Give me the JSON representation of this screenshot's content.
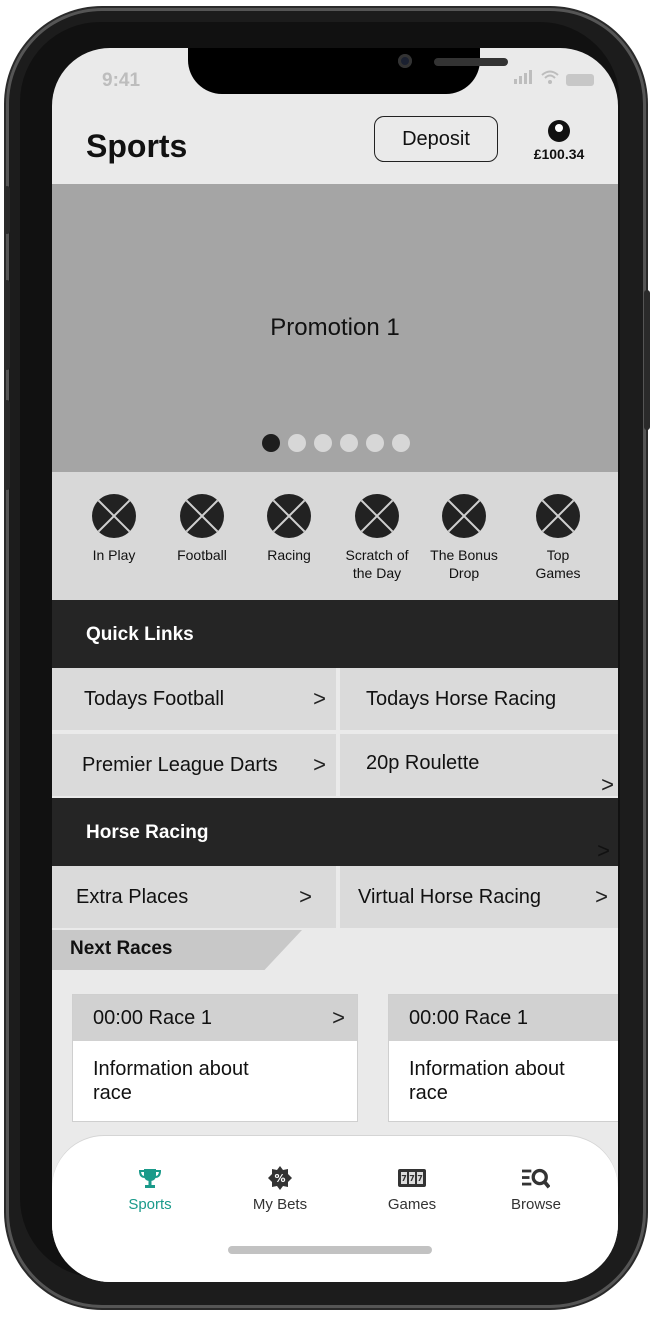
{
  "status_bar": {
    "time": "9:41"
  },
  "header": {
    "title": "Sports",
    "deposit_label": "Deposit",
    "balance": "£100.34"
  },
  "promo": {
    "label": "Promotion 1",
    "slide_count": 6,
    "active_slide": 1
  },
  "categories": [
    {
      "label": "In Play"
    },
    {
      "label": "Football"
    },
    {
      "label": "Racing"
    },
    {
      "label": "Scratch of\nthe Day"
    },
    {
      "label": "The Bonus\nDrop"
    },
    {
      "label": "Top\nGames"
    }
  ],
  "quick_links": {
    "title": "Quick Links",
    "items": [
      {
        "label": "Todays Football"
      },
      {
        "label": "Todays Horse Racing"
      },
      {
        "label": "Premier League Darts"
      },
      {
        "label": "20p Roulette"
      }
    ]
  },
  "horse_racing": {
    "title": "Horse Racing",
    "items": [
      {
        "label": "Extra Places"
      },
      {
        "label": "Virtual Horse Racing"
      }
    ]
  },
  "next_races": {
    "title": "Next Races",
    "races": [
      {
        "time_name": "00:00  Race 1",
        "info": "Information about race"
      },
      {
        "time_name": "00:00  Race 1",
        "info": "Information about race"
      }
    ]
  },
  "tabs": [
    {
      "label": "Sports",
      "icon": "trophy-icon",
      "active": true
    },
    {
      "label": "My Bets",
      "icon": "badge-icon",
      "active": false
    },
    {
      "label": "Games",
      "icon": "slot-machine-icon",
      "active": false
    },
    {
      "label": "Browse",
      "icon": "browse-search-icon",
      "active": false
    }
  ],
  "colors": {
    "accent": "#1a9a8a",
    "dark_bar": "#252525",
    "promo_bg": "#a5a5a5"
  }
}
